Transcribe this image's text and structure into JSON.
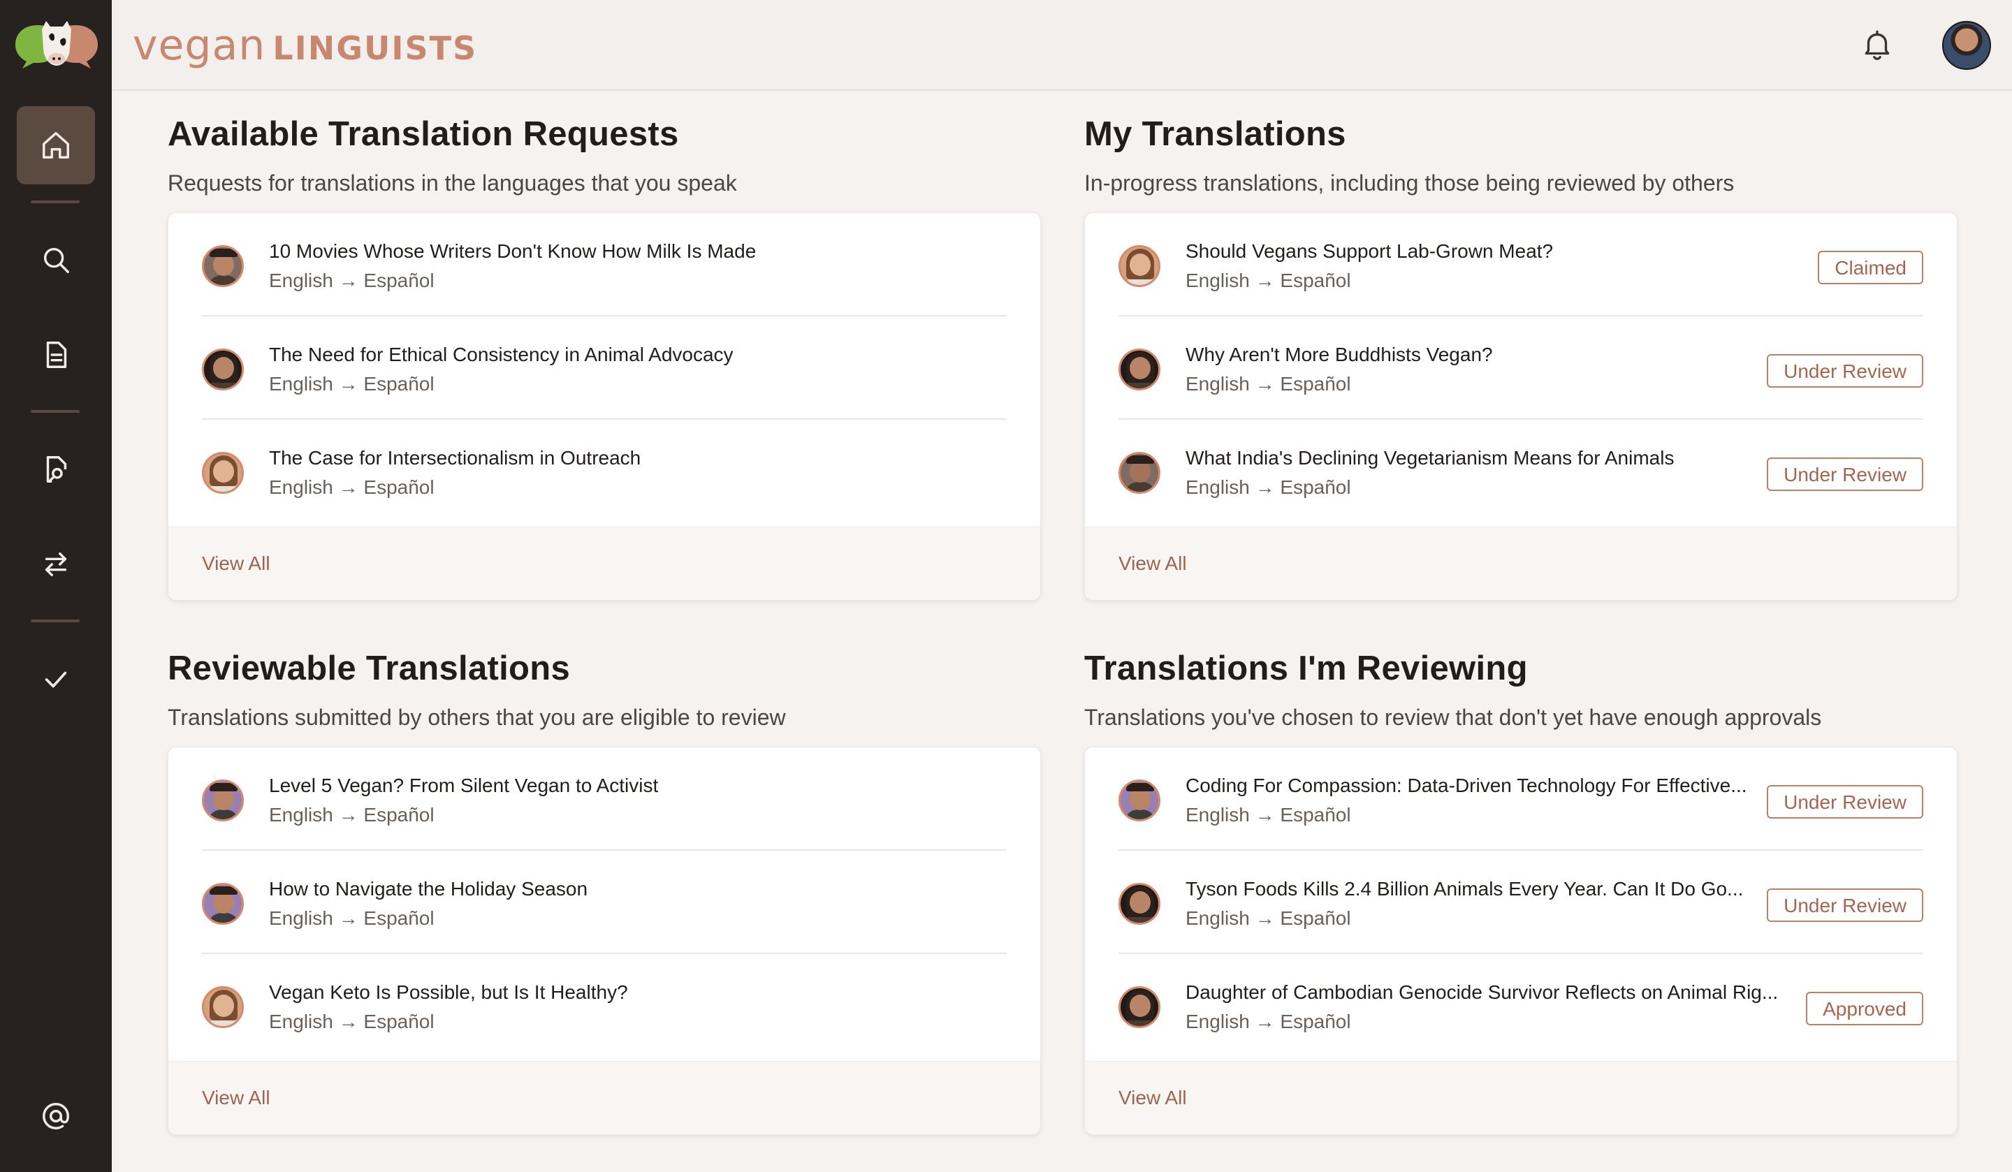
{
  "brand": {
    "part1": "vegan",
    "part2": "LINGUISTS"
  },
  "nav": {
    "items": [
      {
        "name": "home",
        "icon": "home-icon"
      },
      {
        "name": "search",
        "icon": "search-icon"
      },
      {
        "name": "documents",
        "icon": "document-icon"
      },
      {
        "name": "review",
        "icon": "review-document-icon"
      },
      {
        "name": "translate",
        "icon": "swap-arrows-icon"
      },
      {
        "name": "completed",
        "icon": "check-icon"
      },
      {
        "name": "contact",
        "icon": "at-icon"
      }
    ]
  },
  "header": {
    "notifications_icon": "bell-icon",
    "avatar_icon": "user-avatar"
  },
  "colors": {
    "accent": "#c8876f",
    "sidebar": "#272220",
    "active_nav": "#5b4a3f",
    "badge": "#a76551"
  },
  "panels": {
    "available": {
      "title": "Available Translation Requests",
      "subtitle": "Requests for translations in the languages that you speak",
      "items": [
        {
          "title": "10 Movies Whose Writers Don't Know How Milk Is Made",
          "lang": "English → Español"
        },
        {
          "title": "The Need for Ethical Consistency in Animal Advocacy",
          "lang": "English → Español"
        },
        {
          "title": "The Case for Intersectionalism in Outreach",
          "lang": "English → Español"
        }
      ],
      "view_all": "View All"
    },
    "mine": {
      "title": "My Translations",
      "subtitle": "In-progress translations, including those being reviewed by others",
      "items": [
        {
          "title": "Should Vegans Support Lab-Grown Meat?",
          "lang": "English → Español",
          "status": "Claimed"
        },
        {
          "title": "Why Aren't More Buddhists Vegan?",
          "lang": "English → Español",
          "status": "Under Review"
        },
        {
          "title": "What India's Declining Vegetarianism Means for Animals",
          "lang": "English → Español",
          "status": "Under Review"
        }
      ],
      "view_all": "View All"
    },
    "reviewable": {
      "title": "Reviewable Translations",
      "subtitle": "Translations submitted by others that you are eligible to review",
      "items": [
        {
          "title": "Level 5 Vegan? From Silent Vegan to Activist",
          "lang": "English → Español"
        },
        {
          "title": "How to Navigate the Holiday Season",
          "lang": "English → Español"
        },
        {
          "title": "Vegan Keto Is Possible, but Is It Healthy?",
          "lang": "English → Español"
        }
      ],
      "view_all": "View All"
    },
    "reviewing": {
      "title": "Translations I'm Reviewing",
      "subtitle": "Translations you've chosen to review that don't yet have enough approvals",
      "items": [
        {
          "title": "Coding For Compassion: Data-Driven Technology For Effective...",
          "lang": "English → Español",
          "status": "Under Review"
        },
        {
          "title": "Tyson Foods Kills 2.4 Billion Animals Every Year. Can It Do Go...",
          "lang": "English → Español",
          "status": "Under Review"
        },
        {
          "title": "Daughter of Cambodian Genocide Survivor Reflects on Animal Rig...",
          "lang": "English → Español",
          "status": "Approved"
        }
      ],
      "view_all": "View All"
    }
  }
}
